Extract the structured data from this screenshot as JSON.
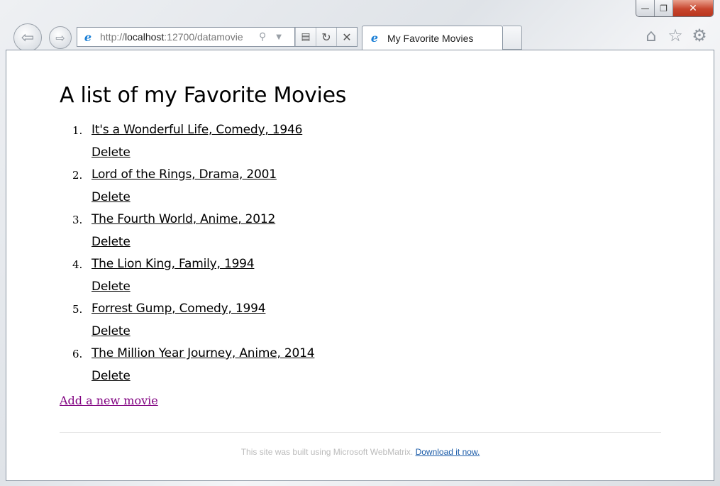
{
  "window": {
    "minimize_glyph": "—",
    "restore_glyph": "❐",
    "close_glyph": "✕"
  },
  "browser": {
    "address": {
      "prefix": "http://",
      "host": "localhost",
      "rest": ":12700/datamovie"
    },
    "tab_title": "My Favorite Movies",
    "icons": [
      "back-arrow-icon",
      "forward-arrow-icon",
      "ie-logo-icon",
      "search-icon",
      "dropdown-icon",
      "compatibility-view-icon",
      "refresh-icon",
      "stop-icon",
      "home-icon",
      "favorites-star-icon",
      "settings-gear-icon"
    ]
  },
  "page": {
    "title": "A list of my Favorite Movies",
    "movies": [
      {
        "num": "1.",
        "label": "It's a Wonderful Life, Comedy, 1946",
        "delete": "Delete"
      },
      {
        "num": "2.",
        "label": "Lord of the Rings, Drama, 2001",
        "delete": "Delete"
      },
      {
        "num": "3.",
        "label": "The Fourth World, Anime, 2012",
        "delete": "Delete"
      },
      {
        "num": "4.",
        "label": "The Lion King, Family, 1994",
        "delete": "Delete"
      },
      {
        "num": "5.",
        "label": "Forrest Gump, Comedy, 1994",
        "delete": "Delete"
      },
      {
        "num": "6.",
        "label": "The Million Year Journey, Anime, 2014",
        "delete": "Delete"
      }
    ],
    "add_link": "Add a new movie",
    "footer_text": "This site was built using Microsoft WebMatrix. ",
    "footer_link": "Download it now."
  },
  "colors": {
    "visited_link": "#800080",
    "footer_link": "#1a5ba8",
    "close_button": "#c7452d"
  }
}
